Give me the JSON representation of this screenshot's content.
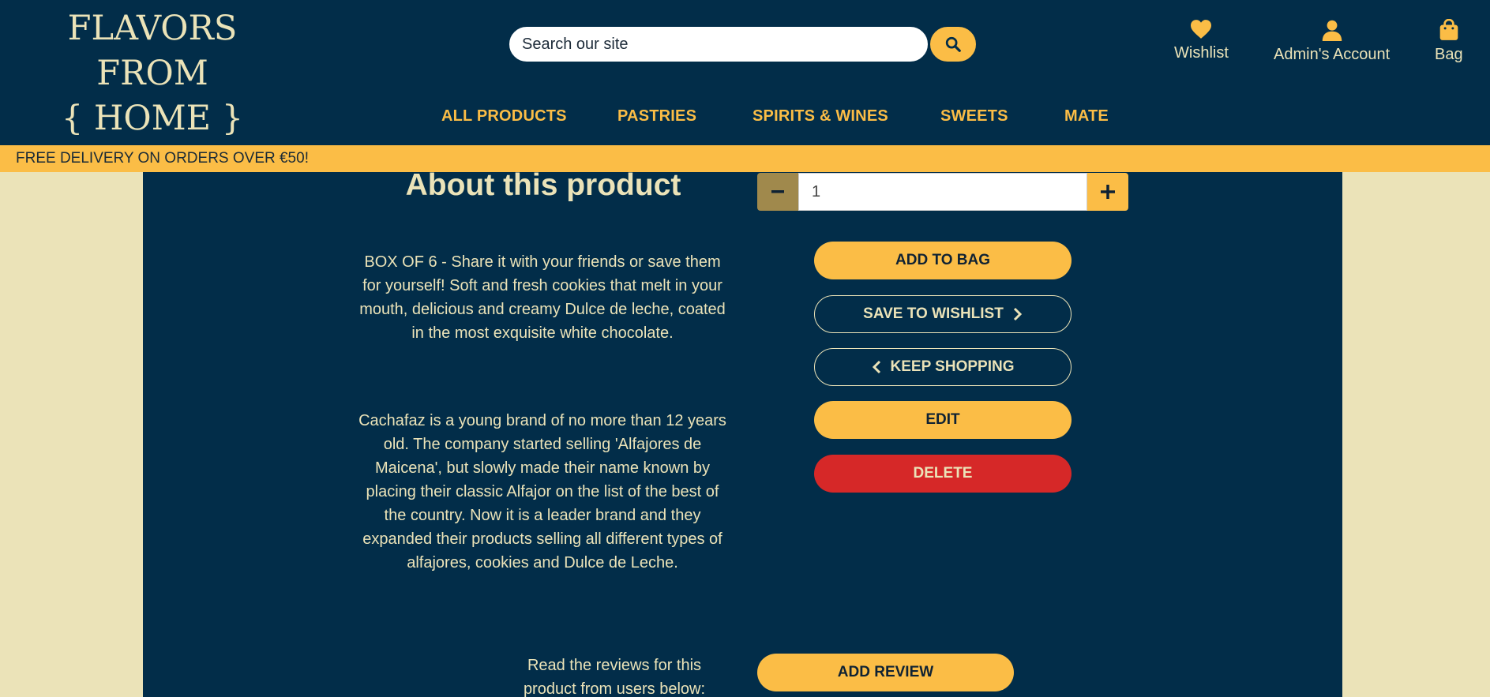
{
  "header": {
    "logo_line1": "FLAVORS FROM",
    "logo_line2": "{ HOME }",
    "search_placeholder": "Search our site",
    "wishlist_label": "Wishlist",
    "account_label": "Admin's Account",
    "bag_label": "Bag"
  },
  "nav": {
    "items": [
      "ALL PRODUCTS",
      "PASTRIES",
      "SPIRITS & WINES",
      "SWEETS",
      "MATE"
    ]
  },
  "banner": {
    "text": "FREE DELIVERY ON ORDERS OVER €50!"
  },
  "product": {
    "about_title": "About this product",
    "description": "BOX OF 6 - Share it with your friends or save them for yourself! Soft and fresh cookies that melt in your mouth, delicious and creamy Dulce de leche, coated in the most exquisite white chocolate.",
    "brand_description": "Cachafaz is a young brand of no more than 12 years old. The company started selling 'Alfajores de Maicena', but slowly made their name known by placing their classic Alfajor on the list of the best of the country. Now it is a leader brand and they expanded their products selling all different types of alfajores, cookies and Dulce de Leche.",
    "quantity": "1",
    "add_to_bag": "ADD TO BAG",
    "save_to_wishlist": "SAVE TO WISHLIST",
    "keep_shopping": "KEEP SHOPPING",
    "edit": "EDIT",
    "delete": "DELETE"
  },
  "reviews": {
    "prompt": "Read the reviews for this product from users below:",
    "add_review": "ADD REVIEW"
  },
  "colors": {
    "navy": "#022d49",
    "cream": "#ebe3b8",
    "yellow": "#fbbd46",
    "red": "#d62828"
  }
}
